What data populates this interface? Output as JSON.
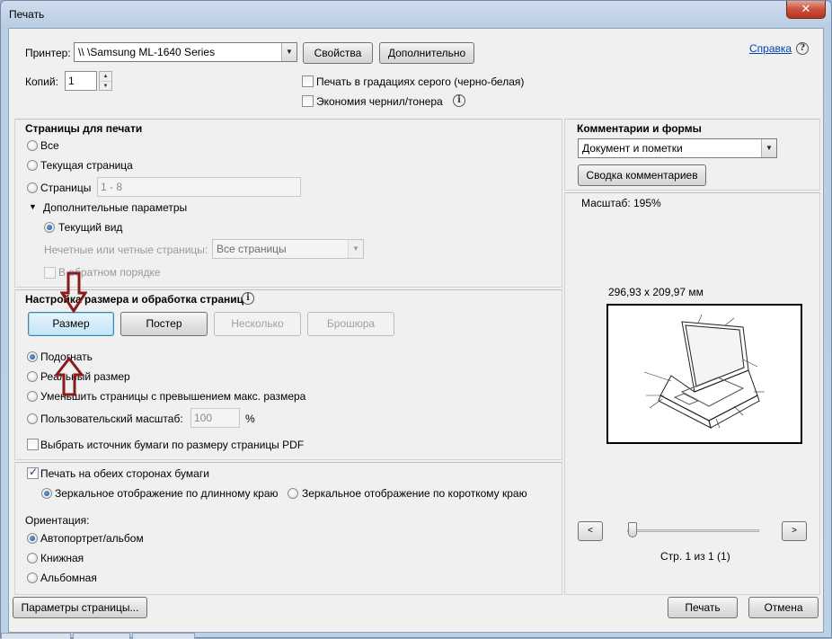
{
  "window": {
    "title": "Печать",
    "close_glyph": "✕"
  },
  "printer": {
    "label": "Принтер:",
    "value": "\\\\      \\Samsung ML-1640 Series",
    "properties_button": "Свойства",
    "advanced_button": "Дополнительно",
    "help_link": "Справка",
    "help_glyph": "?"
  },
  "copies": {
    "label": "Копий:",
    "value": "1"
  },
  "options": {
    "grayscale": {
      "label": "Печать в градациях серого (черно-белая)",
      "checked": false
    },
    "save_ink": {
      "label": "Экономия чернил/тонера",
      "checked": false
    }
  },
  "pages_section": {
    "title": "Страницы для печати",
    "all": "Все",
    "current": "Текущая страница",
    "pages": "Страницы",
    "pages_value": "1 - 8",
    "more_options": "Дополнительные параметры",
    "current_view": "Текущий вид",
    "odd_even_label": "Нечетные или четные страницы:",
    "odd_even_value": "Все страницы",
    "reverse": "В обратном порядке"
  },
  "sizing_section": {
    "title": "Настройка размера и обработка страниц",
    "size_button": "Размер",
    "poster_button": "Постер",
    "multiple_button": "Несколько",
    "booklet_button": "Брошюра",
    "fit": "Подогнать",
    "actual_size": "Реальный размер",
    "shrink": "Уменьшить страницы с превышением макс. размера",
    "custom_scale": "Пользовательский масштаб:",
    "custom_scale_value": "100",
    "percent": "%",
    "paper_source": "Выбрать источник бумаги по размеру страницы PDF"
  },
  "duplex_section": {
    "both_sides": "Печать на обеих сторонах бумаги",
    "flip_long": "Зеркальное отображение по длинному краю",
    "flip_short": "Зеркальное отображение по короткому краю"
  },
  "orientation_section": {
    "title": "Ориентация:",
    "auto": "Автопортрет/альбом",
    "portrait": "Книжная",
    "landscape": "Альбомная"
  },
  "comments_section": {
    "title": "Комментарии и формы",
    "value": "Документ и пометки",
    "summarize_button": "Сводка комментариев"
  },
  "preview": {
    "scale": "Масштаб: 195%",
    "dimensions": "296,93 x 209,97 мм",
    "page_info": "Стр. 1 из 1 (1)",
    "prev_glyph": "<",
    "next_glyph": ">"
  },
  "footer": {
    "page_setup_button": "Параметры страницы...",
    "print_button": "Печать",
    "cancel_button": "Отмена"
  },
  "colors": {
    "annotation_arrow": "#8b1a1a"
  }
}
